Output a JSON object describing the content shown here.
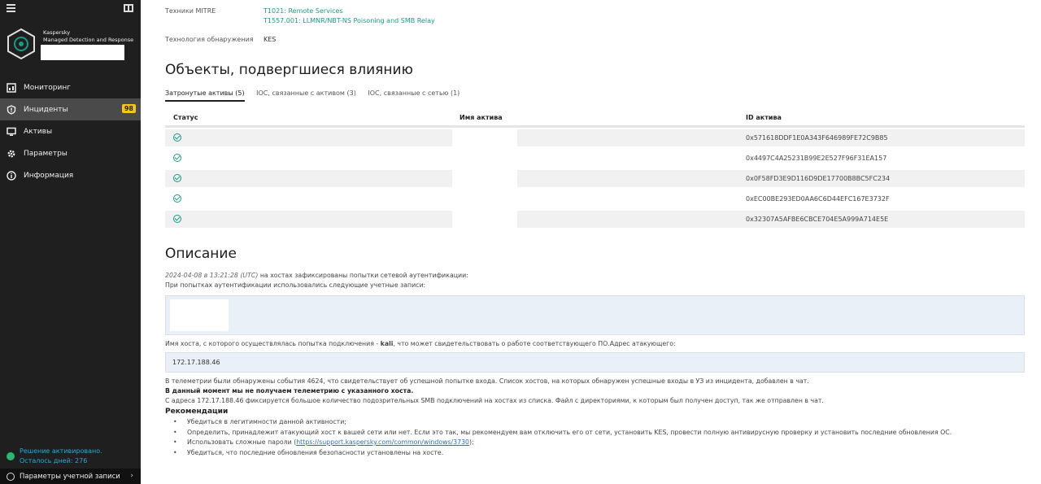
{
  "sidebar": {
    "brand_line1": "Kaspersky",
    "brand_line2": "Managed Detection and Response",
    "nav": [
      {
        "label": "Мониторинг",
        "icon": "monitoring-icon"
      },
      {
        "label": "Инциденты",
        "icon": "incidents-icon",
        "badge": "98",
        "active": true
      },
      {
        "label": "Активы",
        "icon": "assets-icon"
      },
      {
        "label": "Параметры",
        "icon": "gear-icon"
      },
      {
        "label": "Информация",
        "icon": "info-icon"
      }
    ],
    "license_line1": "Решение активировано.",
    "license_line2": "Осталось дней: 276",
    "account_label": "Параметры учетной записи"
  },
  "details": {
    "mitre_label": "Техники MITRE",
    "mitre_values": [
      "T1021: Remote Services",
      "T1557.001: LLMNR/NBT-NS Poisoning and SMB Relay"
    ],
    "tech_label": "Технология обнаружения",
    "tech_value": "KES"
  },
  "affected": {
    "title": "Объекты, подвергшиеся влиянию",
    "tabs": [
      "Затронутые активы (5)",
      "IOC, связанные с активом (3)",
      "IOC, связанные с сетью (1)"
    ],
    "columns": [
      "Статус",
      "Имя актива",
      "ID актива"
    ],
    "rows": [
      {
        "asset_id": "0x571618DDF1E0A343F646989FE72C9B85"
      },
      {
        "asset_id": "0x4497C4A25231B99E2E527F96F31EA157"
      },
      {
        "asset_id": "0x0F58FD3E9D116D9DE17700B8BC5FC234"
      },
      {
        "asset_id": "0xEC00BE293ED0AA6C6D44EFC167E3732F"
      },
      {
        "asset_id": "0x32307A5AFBE6CBCE704E5A999A714E5E"
      }
    ]
  },
  "description": {
    "title": "Описание",
    "line1_time": "2024-04-08 в 13:21:28 (UTC)",
    "line1_rest": " на хостах зафиксированы попытки сетевой аутентификации:",
    "line2": "При попытках аутентификации использовались следующие учетные записи:",
    "host_line_a": "Имя хоста, с которого осуществлялась попытка подключения - ",
    "host_name": "kali",
    "host_line_b": ", что может свидетельствовать о работе соответствующего ПО.Адрес атакующего:",
    "ip": "172.17.188.46",
    "tele_line1": "В телеметрии были обнаружены события 4624, что свидетельствует об успешной попытке входа. Список хостов, на которых обнаружен успешные входы в УЗ из инцидента, добавлен в чат.",
    "tele_line2": "В данный момент мы не получаем телеметрию с указанного хоста.",
    "tele_line3": "С адреса 172.17.188.46 фиксируется большое количество подозрительных SMB подключений на хостах из списка. Файл с директориями, к которым был получен доступ, так же отправлен в чат.",
    "rec_title": "Рекомендации",
    "rec1": "Убедиться в легитимности данной активности;",
    "rec2": "Определить, принадлежит атакующий хост к вашей сети или нет. Если это так, мы рекомендуем вам отключить его от сети, установить KES, провести полную антивирусную проверку и установить последние обновления ОС.",
    "rec3_a": "Использовать сложные пароли (",
    "rec3_link": "https://support.kaspersky.com/common/windows/3730",
    "rec3_b": ");",
    "rec4": "Убедиться, что последние обновления безопасности установлены на хосте."
  },
  "colors": {
    "accent_green": "#1a9a86",
    "badge_yellow": "#f5c518",
    "sidebar_bg": "#1f1f1f"
  }
}
